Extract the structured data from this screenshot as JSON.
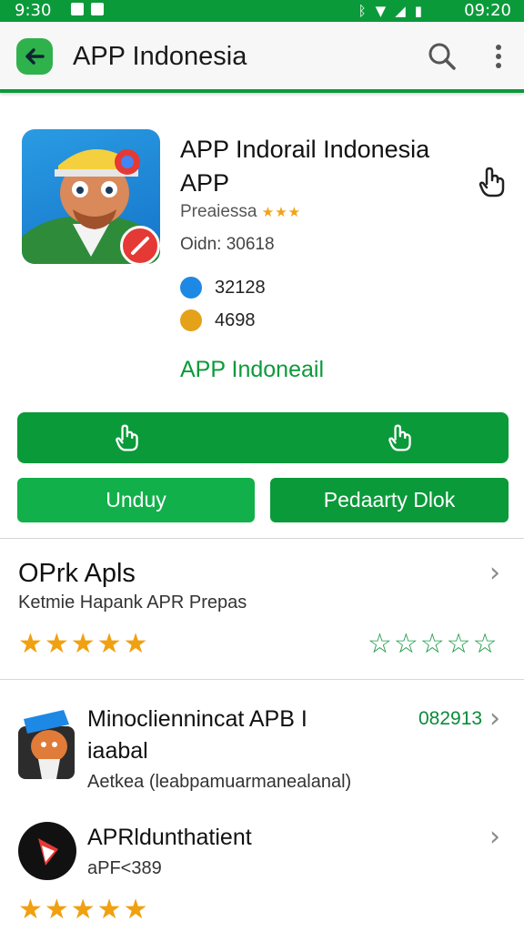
{
  "status_bar": {
    "time_left": "9:30",
    "time_right": "09:20"
  },
  "app_bar": {
    "title": "APP Indonesia"
  },
  "app": {
    "title": "APP Indorail Indonesia APP",
    "publisher": "Preaiessa",
    "publisher_stars": "★★★",
    "orders": "Oidn: 30618",
    "stat1": "32128",
    "stat2": "4698",
    "developer_link": "APP Indoneail"
  },
  "buttons": {
    "unduh": "Unduy",
    "pedaarty": "Pedaarty Dlok"
  },
  "section": {
    "title": "OPrk Apls",
    "subtitle": "Ketmie Hapank APR Prepas",
    "rating_stars": "★★★★★",
    "outline_stars": "☆☆☆☆☆"
  },
  "list": [
    {
      "title_line1": "Minocliennincat APB I",
      "title_line2": "iaabal",
      "subtitle": "Aetkea (leabpamuarmanealanal)",
      "meta": "082913"
    },
    {
      "title": "APRldunthatient",
      "subtitle": "aPF<389",
      "stars": "★★★★★"
    }
  ],
  "colors": {
    "brand_green": "#0b9a3a",
    "star_gold": "#f0a010",
    "danger": "#e53935"
  }
}
